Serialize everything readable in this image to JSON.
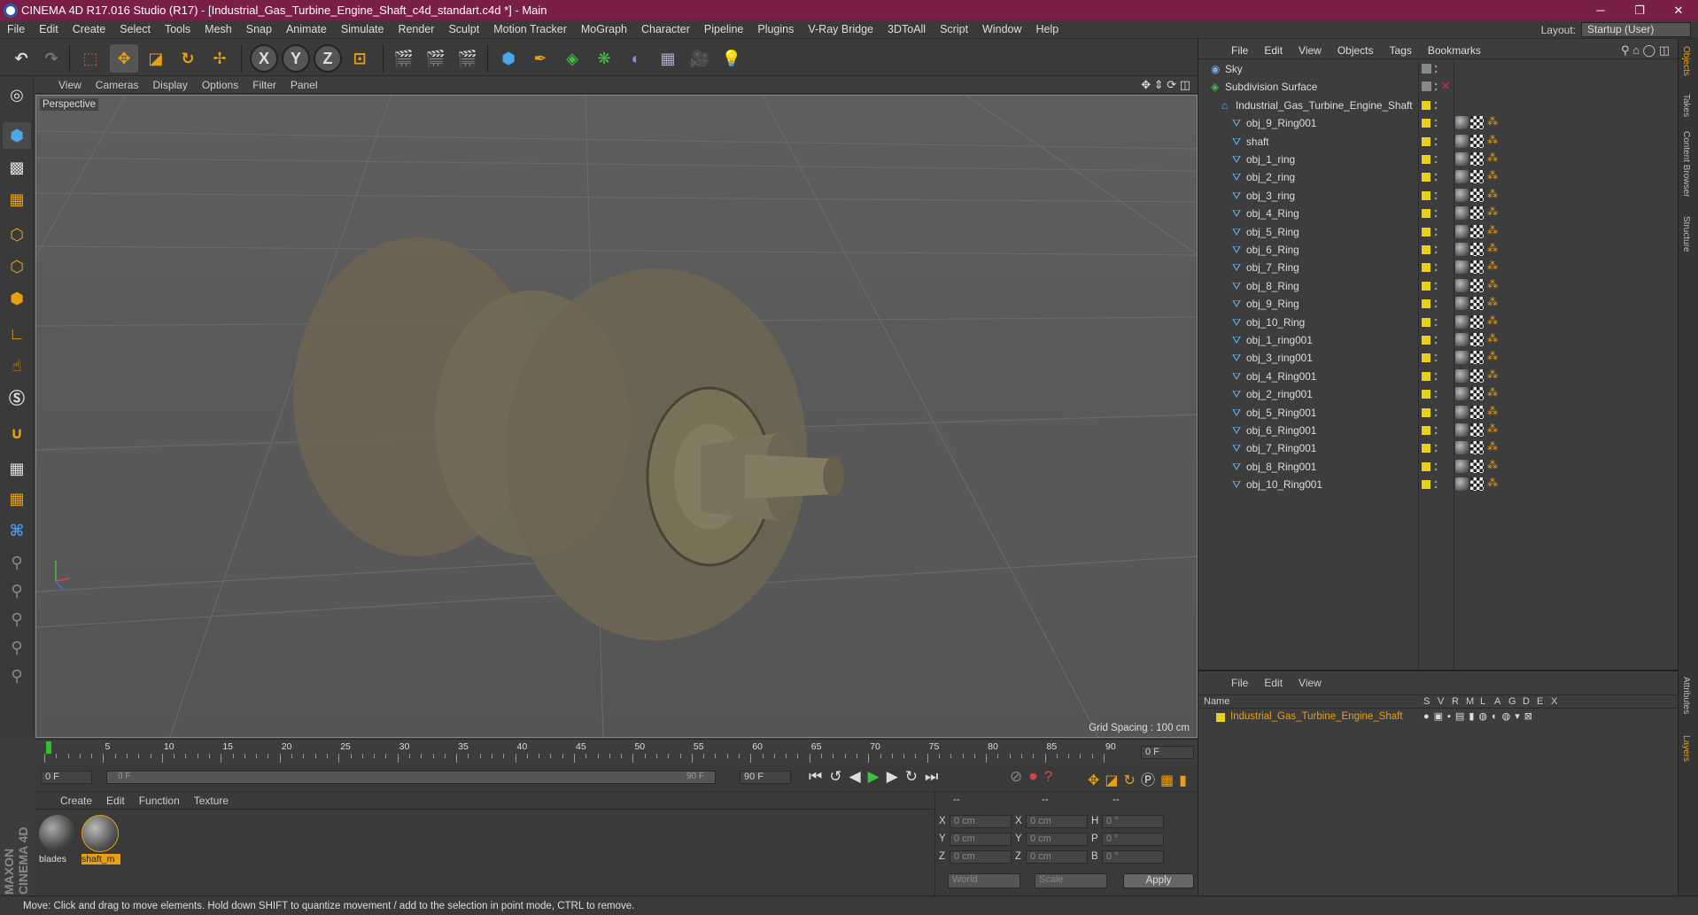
{
  "window": {
    "title": "CINEMA 4D R17.016 Studio (R17) - [Industrial_Gas_Turbine_Engine_Shaft_c4d_standart.c4d *] - Main",
    "min": "─",
    "max": "❐",
    "close": "✕"
  },
  "menu": [
    "File",
    "Edit",
    "Create",
    "Select",
    "Tools",
    "Mesh",
    "Snap",
    "Animate",
    "Simulate",
    "Render",
    "Sculpt",
    "Motion Tracker",
    "MoGraph",
    "Character",
    "Pipeline",
    "Plugins",
    "V-Ray Bridge",
    "3DToAll",
    "Script",
    "Window",
    "Help"
  ],
  "layout": {
    "label": "Layout:",
    "value": "Startup (User)"
  },
  "toolbar": {
    "x": "X",
    "y": "Y",
    "z": "Z"
  },
  "viewport": {
    "menu": [
      "View",
      "Cameras",
      "Display",
      "Options",
      "Filter",
      "Panel"
    ],
    "label": "Perspective",
    "grid_spacing": "Grid Spacing : 100 cm"
  },
  "timeline": {
    "ticks": [
      "0",
      "5",
      "10",
      "15",
      "20",
      "25",
      "30",
      "35",
      "40",
      "45",
      "50",
      "55",
      "60",
      "65",
      "70",
      "75",
      "80",
      "85",
      "90"
    ],
    "current": "0 F",
    "start": "0 F",
    "slider_start": "0 F",
    "slider_end": "90 F",
    "end": "90 F"
  },
  "materials": {
    "menu": [
      "Create",
      "Edit",
      "Function",
      "Texture"
    ],
    "items": [
      "blades",
      "shaft_m"
    ]
  },
  "coords": {
    "header": [
      "--",
      "--",
      "--"
    ],
    "rows": [
      {
        "a": "X",
        "av": "0 cm",
        "b": "X",
        "bv": "0 cm",
        "c": "H",
        "cv": "0 °"
      },
      {
        "a": "Y",
        "av": "0 cm",
        "b": "Y",
        "bv": "0 cm",
        "c": "P",
        "cv": "0 °"
      },
      {
        "a": "Z",
        "av": "0 cm",
        "b": "Z",
        "bv": "0 cm",
        "c": "B",
        "cv": "0 °"
      }
    ],
    "world": "World",
    "scale": "Scale",
    "apply": "Apply"
  },
  "objects": {
    "menu": [
      "File",
      "Edit",
      "View",
      "Objects",
      "Tags",
      "Bookmarks"
    ],
    "items": [
      {
        "name": "Sky",
        "indent": 0
      },
      {
        "name": "Subdivision Surface",
        "indent": 0
      },
      {
        "name": "Industrial_Gas_Turbine_Engine_Shaft",
        "indent": 1
      },
      {
        "name": "obj_9_Ring001",
        "indent": 2
      },
      {
        "name": "shaft",
        "indent": 2
      },
      {
        "name": "obj_1_ring",
        "indent": 2
      },
      {
        "name": "obj_2_ring",
        "indent": 2
      },
      {
        "name": "obj_3_ring",
        "indent": 2
      },
      {
        "name": "obj_4_Ring",
        "indent": 2
      },
      {
        "name": "obj_5_Ring",
        "indent": 2
      },
      {
        "name": "obj_6_Ring",
        "indent": 2
      },
      {
        "name": "obj_7_Ring",
        "indent": 2
      },
      {
        "name": "obj_8_Ring",
        "indent": 2
      },
      {
        "name": "obj_9_Ring",
        "indent": 2
      },
      {
        "name": "obj_10_Ring",
        "indent": 2
      },
      {
        "name": "obj_1_ring001",
        "indent": 2
      },
      {
        "name": "obj_3_ring001",
        "indent": 2
      },
      {
        "name": "obj_4_Ring001",
        "indent": 2
      },
      {
        "name": "obj_2_ring001",
        "indent": 2
      },
      {
        "name": "obj_5_Ring001",
        "indent": 2
      },
      {
        "name": "obj_6_Ring001",
        "indent": 2
      },
      {
        "name": "obj_7_Ring001",
        "indent": 2
      },
      {
        "name": "obj_8_Ring001",
        "indent": 2
      },
      {
        "name": "obj_10_Ring001",
        "indent": 2
      }
    ]
  },
  "layers": {
    "menu": [
      "File",
      "Edit",
      "View"
    ],
    "columns": [
      "Name",
      "S",
      "V",
      "R",
      "M",
      "L",
      "A",
      "G",
      "D",
      "E",
      "X"
    ],
    "item": "Industrial_Gas_Turbine_Engine_Shaft"
  },
  "right_tabs": [
    "Objects",
    "Takes",
    "Content Browser",
    "Structure",
    "Attributes",
    "Layers"
  ],
  "status": "Move: Click and drag to move elements. Hold down SHIFT to quantize movement / add to the selection in point mode, CTRL to remove.",
  "colors": {
    "titlebar": "#7a1f45",
    "accent": "#e8a010",
    "layer": "#e8d020"
  }
}
